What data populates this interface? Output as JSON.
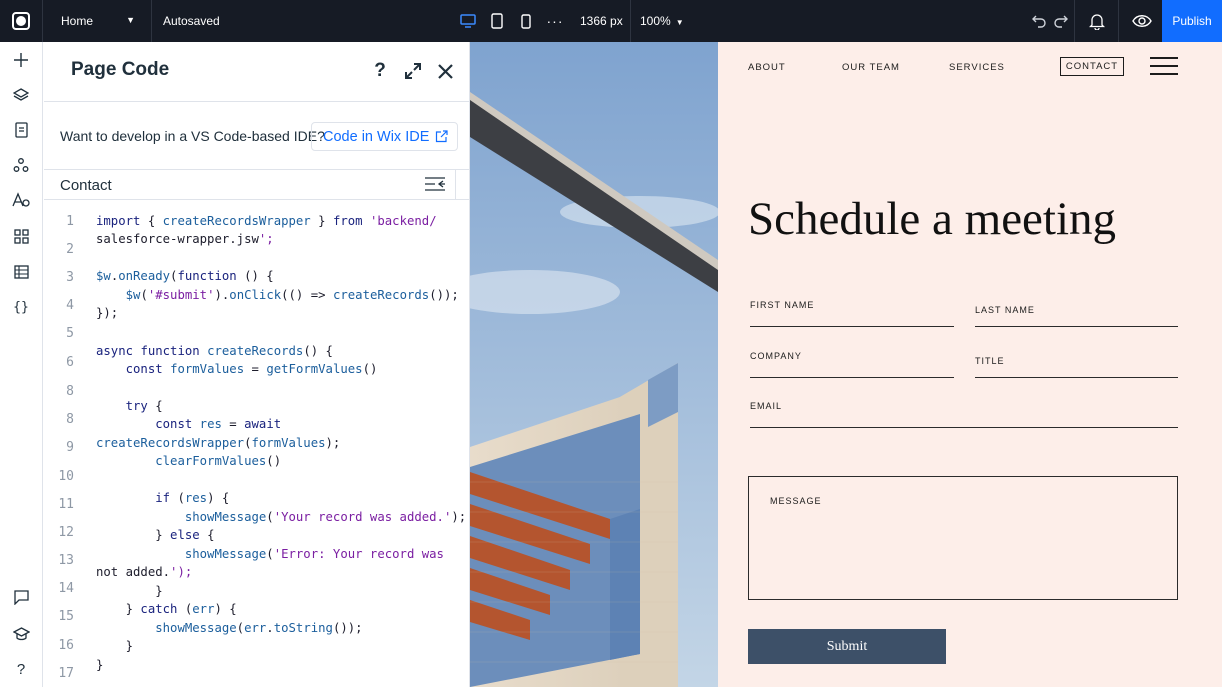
{
  "topbar": {
    "page_name": "Home",
    "status": "Autosaved",
    "width_readout": "1366 px",
    "zoom": "100%",
    "publish_label": "Publish",
    "accent_color": "#116dff"
  },
  "rail": {
    "icons": [
      "add-icon",
      "layers-icon",
      "pages-icon",
      "apps-icon",
      "design-icon",
      "widgets-icon",
      "cms-table-icon",
      "code-braces-icon",
      "chat-icon",
      "learn-icon",
      "help-icon"
    ]
  },
  "panel": {
    "title": "Page Code",
    "ide_question": "Want to develop in a VS Code-based IDE?",
    "ide_button": "Code in Wix IDE",
    "file_tab": "Contact",
    "line_numbers": [
      "1",
      "2",
      "3",
      "4",
      "5",
      "6",
      "8",
      "8",
      "9",
      "10",
      "11",
      "12",
      "13",
      "14",
      "15",
      "16",
      "17"
    ],
    "code_lines": [
      "import { createRecordsWrapper } from 'backend/",
      "salesforce-wrapper.jsw';",
      "",
      "$w.onReady(function () {",
      "    $w('#submit').onClick(() => createRecords());",
      "});",
      "",
      "async function createRecords() {",
      "    const formValues = getFormValues()",
      "",
      "    try {",
      "        const res = await",
      "createRecordsWrapper(formValues);",
      "        clearFormValues()",
      "",
      "        if (res) {",
      "            showMessage('Your record was added.');",
      "        } else {",
      "            showMessage('Error: Your record was",
      "not added.');",
      "        }",
      "    } catch (err) {",
      "        showMessage(err.toString());",
      "    }",
      "}"
    ]
  },
  "site": {
    "nav": [
      "ABOUT",
      "OUR TEAM",
      "SERVICES",
      "CONTACT"
    ],
    "heading": "Schedule a meeting",
    "fields": {
      "first_name": "FIRST NAME",
      "last_name": "LAST NAME",
      "company": "COMPANY",
      "title": "TITLE",
      "email": "EMAIL",
      "message": "MESSAGE"
    },
    "submit_label": "Submit",
    "background": "#fdeee9",
    "button_color": "#3d5068"
  }
}
